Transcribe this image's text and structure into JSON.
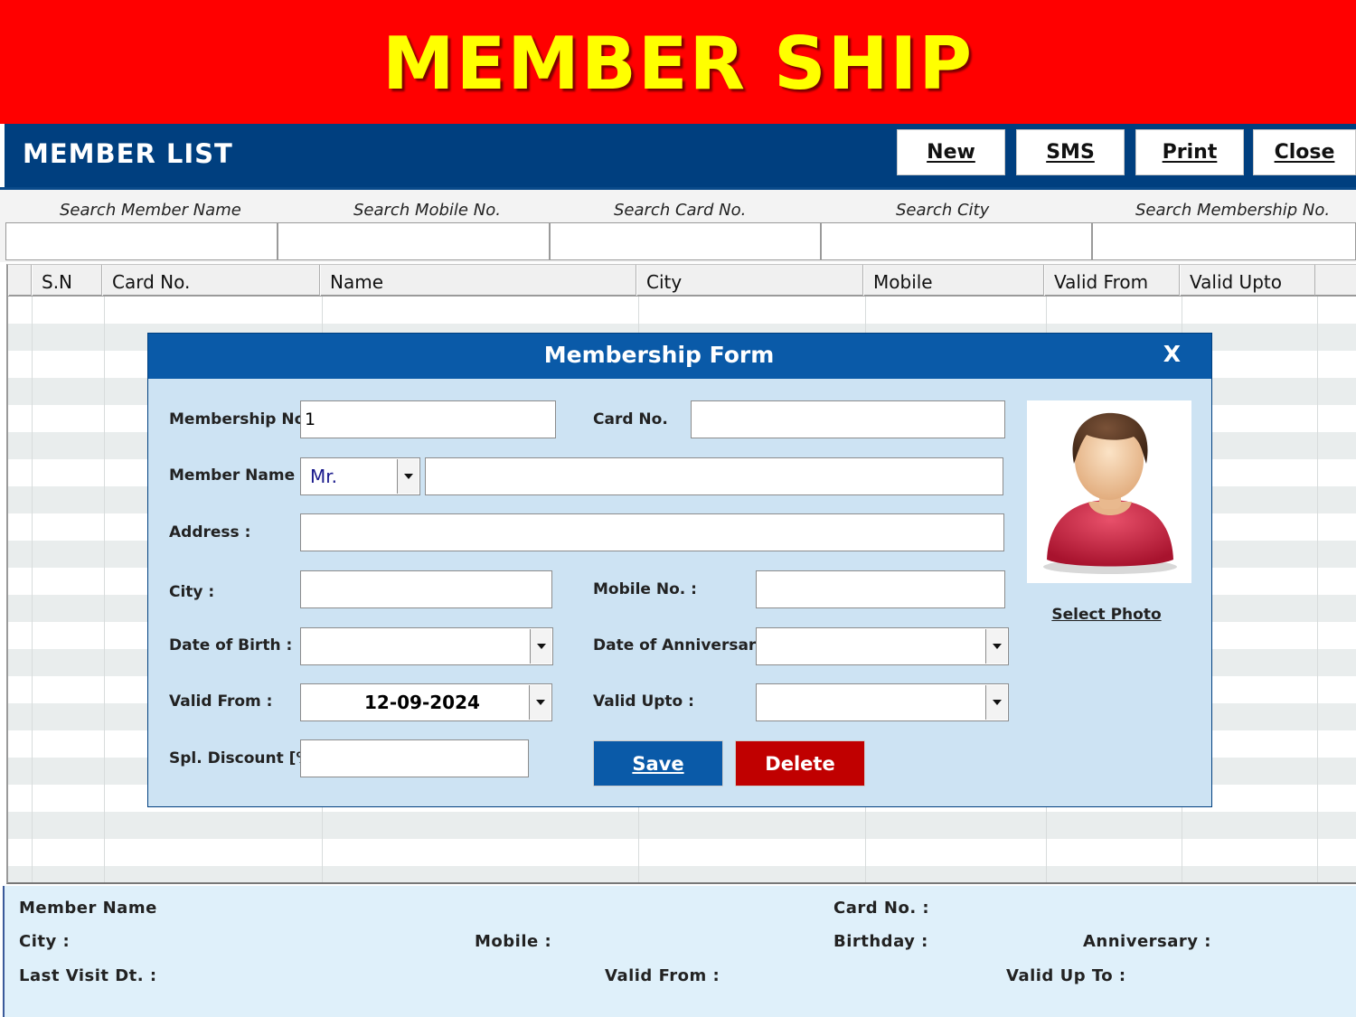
{
  "banner": {
    "title": "MEMBER SHIP"
  },
  "header": {
    "title": "MEMBER LIST",
    "buttons": {
      "new": "New",
      "sms": "SMS",
      "print": "Print",
      "close": "Close"
    }
  },
  "search": {
    "member_name": {
      "label": "Search Member Name",
      "value": ""
    },
    "mobile": {
      "label": "Search Mobile No.",
      "value": ""
    },
    "card": {
      "label": "Search Card No.",
      "value": ""
    },
    "city": {
      "label": "Search City",
      "value": ""
    },
    "membership": {
      "label": "Search Membership No.",
      "value": ""
    }
  },
  "grid": {
    "columns": [
      "S.N",
      "Card No.",
      "Name",
      "City",
      "Mobile",
      "Valid From",
      "Valid Upto"
    ],
    "rows": []
  },
  "modal": {
    "title": "Membership Form",
    "close": "X",
    "fields": {
      "membership_no": {
        "label": "Membership No.",
        "value": "1"
      },
      "card_no": {
        "label": "Card No.",
        "value": ""
      },
      "member_name": {
        "label": "Member Name",
        "title_value": "Mr.",
        "value": ""
      },
      "address": {
        "label": "Address :",
        "value": ""
      },
      "city": {
        "label": "City :",
        "value": ""
      },
      "mobile": {
        "label": "Mobile No. :",
        "value": ""
      },
      "dob": {
        "label": "Date of Birth :",
        "value": ""
      },
      "anniversary": {
        "label": "Date of Anniversary :",
        "value": ""
      },
      "valid_from": {
        "label": "Valid From :",
        "value": "12-09-2024"
      },
      "valid_upto": {
        "label": "Valid Upto :",
        "value": ""
      },
      "discount": {
        "label": "Spl. Discount [%]",
        "value": ""
      }
    },
    "select_photo": "Select Photo",
    "save": "Save",
    "delete": "Delete"
  },
  "footer": {
    "member_name": "Member Name",
    "card_no": "Card No. :",
    "city": "City :",
    "mobile": "Mobile :",
    "birthday": "Birthday :",
    "anniversary": "Anniversary :",
    "last_visit": "Last Visit Dt. :",
    "valid_from": "Valid From :",
    "valid_upto": "Valid Up To :"
  },
  "colors": {
    "banner": "#ff0000",
    "banner_text": "#ffff00",
    "header": "#003f7f",
    "modal_title": "#0a5aa8",
    "modal_bg": "#cde3f3",
    "save": "#0a5aa8",
    "delete": "#c00000",
    "footer_bg": "#dff0fa",
    "title_select_text": "#1a1a8c"
  }
}
